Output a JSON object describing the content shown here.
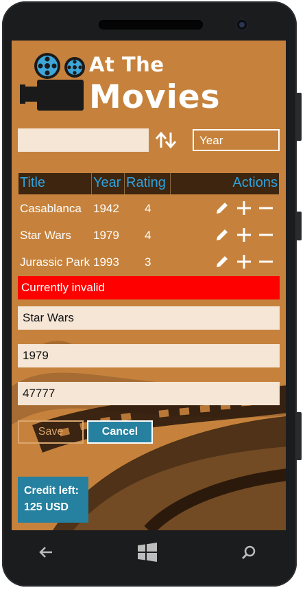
{
  "app": {
    "title_line1": "At The",
    "title_line2": "Movies"
  },
  "search": {
    "value": "",
    "placeholder": ""
  },
  "sort_field": {
    "selected": "Year"
  },
  "table": {
    "headers": [
      "Title",
      "Year",
      "Rating",
      "Actions"
    ],
    "rows": [
      {
        "title": "Casablanca",
        "year": "1942",
        "rating": "4"
      },
      {
        "title": "Star Wars",
        "year": "1979",
        "rating": "4"
      },
      {
        "title": "Jurassic Park",
        "year": "1993",
        "rating": "3"
      }
    ]
  },
  "form": {
    "status": "Currently invalid",
    "title_value": "Star Wars",
    "year_value": "1979",
    "rating_value": "47777",
    "save_label": "Save",
    "cancel_label": "Cancel"
  },
  "credit": {
    "line1": "Credit left:",
    "line2": "125 USD"
  },
  "nav": {
    "back": "back-icon",
    "home": "windows-icon",
    "search": "search-icon"
  },
  "colors": {
    "background": "#c6823c",
    "header_bar": "#3d250f",
    "header_text": "#2ea3e0",
    "error": "#ff0000",
    "button_accent": "#26809f",
    "field": "#f5e6d6"
  }
}
